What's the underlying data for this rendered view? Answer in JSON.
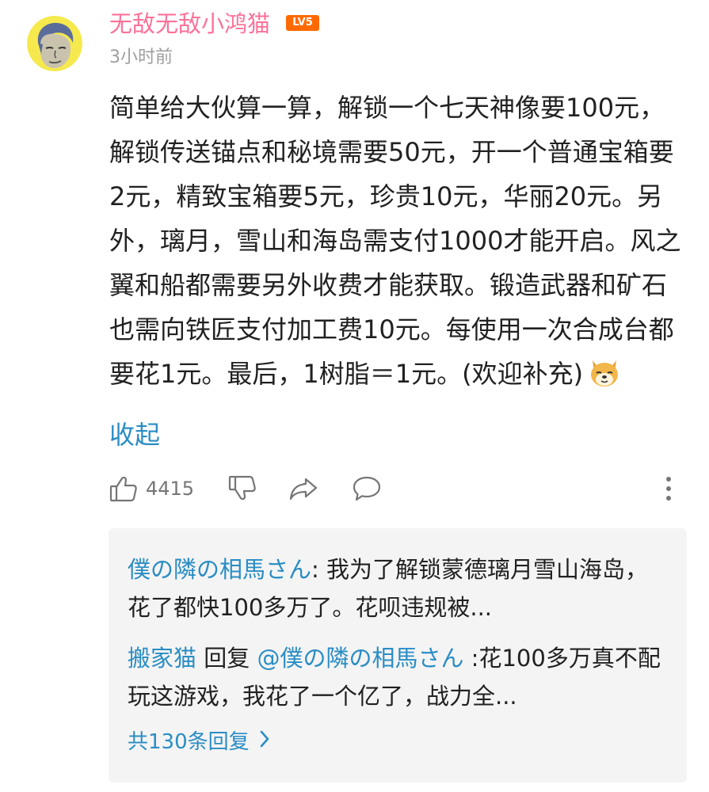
{
  "comment": {
    "username": "无敌无敌小鸿猫",
    "level": "LV5",
    "time": "3小时前",
    "text": "简单给大伙算一算，解锁一个七天神像要100元，解锁传送锚点和秘境需要50元，开一个普通宝箱要2元，精致宝箱要5元，珍贵10元，华丽20元。另外，璃月，雪山和海岛需支付1000才能开启。风之翼和船都需要另外收费才能获取。锻造武器和矿石也需向铁匠支付加工费10元。每使用一次合成台都要花1元。最后，1树脂＝1元。(欢迎补充)",
    "emoji": "doge-emoji",
    "collapse_label": "收起"
  },
  "actions": {
    "like_count": "4415",
    "icons": [
      "thumbs-up-icon",
      "thumbs-down-icon",
      "share-icon",
      "reply-icon",
      "more-icon"
    ]
  },
  "replies": {
    "items": [
      {
        "author": "僕の隣の相馬さん",
        "separator": ": ",
        "text": "我为了解锁蒙德璃月雪山海岛，花了都快100多万了。花呗违规被..."
      },
      {
        "author": "搬家猫",
        "reply_word": " 回复 ",
        "mention": "@僕の隣の相馬さん",
        "separator": " :",
        "text": "花100多万真不配玩这游戏，我花了一个亿了，战力全..."
      }
    ],
    "more_label": "共130条回复"
  },
  "colors": {
    "username": "#fb7299",
    "link": "#2a8dc4",
    "level_badge": "#ff6a00",
    "reply_bg": "#f4f4f4"
  }
}
